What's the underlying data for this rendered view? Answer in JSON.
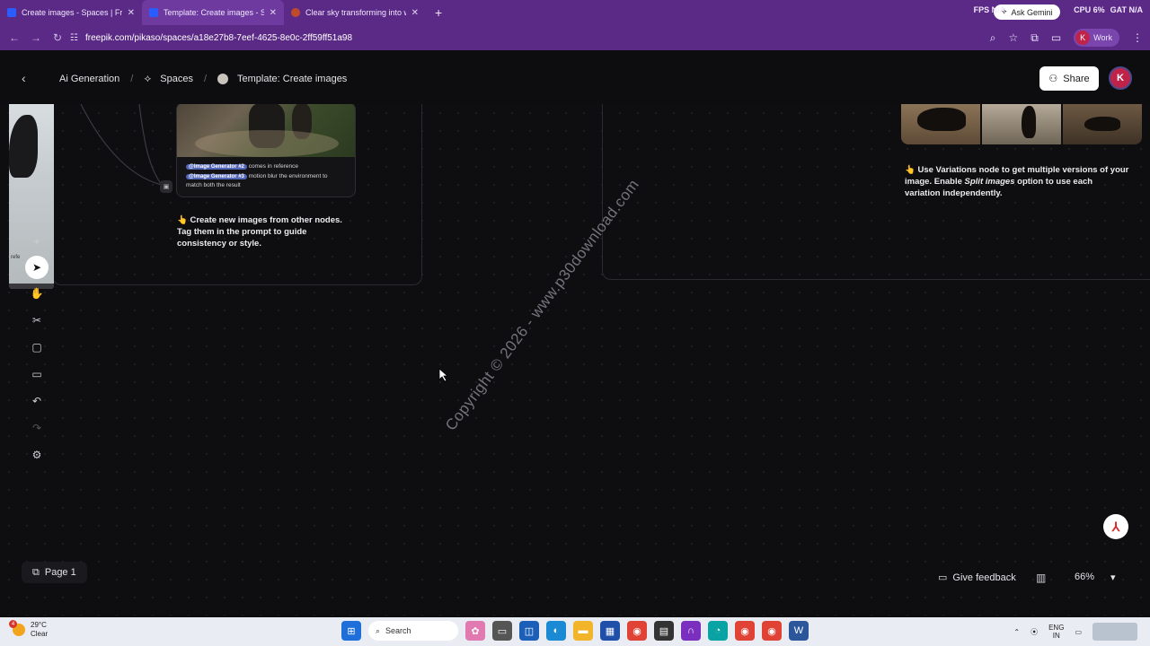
{
  "browser": {
    "tabs": [
      {
        "title": "Create images - Spaces | Freepik",
        "active": false
      },
      {
        "title": "Template: Create images - Spaces",
        "active": true
      },
      {
        "title": "Clear sky transforming into wa...",
        "active": false
      }
    ],
    "gemini_label": "Ask Gemini",
    "sys": {
      "fps": "FPS N/A",
      "cpu": "CPU 6%",
      "gpu": "GAT N/A"
    },
    "url": "freepik.com/pikaso/spaces/a18e27b8-7eef-4625-8e0c-2ff59ff51a98",
    "profile_initial": "K",
    "profile_label": "Work"
  },
  "header": {
    "breadcrumb": [
      "Ai Generation",
      "Spaces",
      "Template: Create images"
    ],
    "share_label": "Share",
    "avatar_initial": "K"
  },
  "canvas": {
    "image_node": {
      "tag1": "@Image Generator #2",
      "line1_rest": "comes in reference",
      "tag2": "@Image Generator #3",
      "line2_rest": "motion blur the environment to",
      "line3": "match both the result"
    },
    "note_create": "👆 Create new images from other nodes. Tag them in the prompt to guide consistency or style.",
    "note_variations_a": "👆 Use Variations node to get multiple versions of your image. Enable ",
    "note_variations_em": "Split images",
    "note_variations_b": " option to use each variation independently.",
    "strip_label": "refe",
    "watermark": "Copyright © 2026 - www.p30download.com"
  },
  "footer": {
    "page_label": "Page 1",
    "feedback_label": "Give feedback",
    "zoom": "66%"
  },
  "taskbar": {
    "temp": "29°C",
    "condition": "Clear",
    "badge": "4",
    "search_label": "Search",
    "lang_top": "ENG",
    "lang_bottom": "IN"
  }
}
